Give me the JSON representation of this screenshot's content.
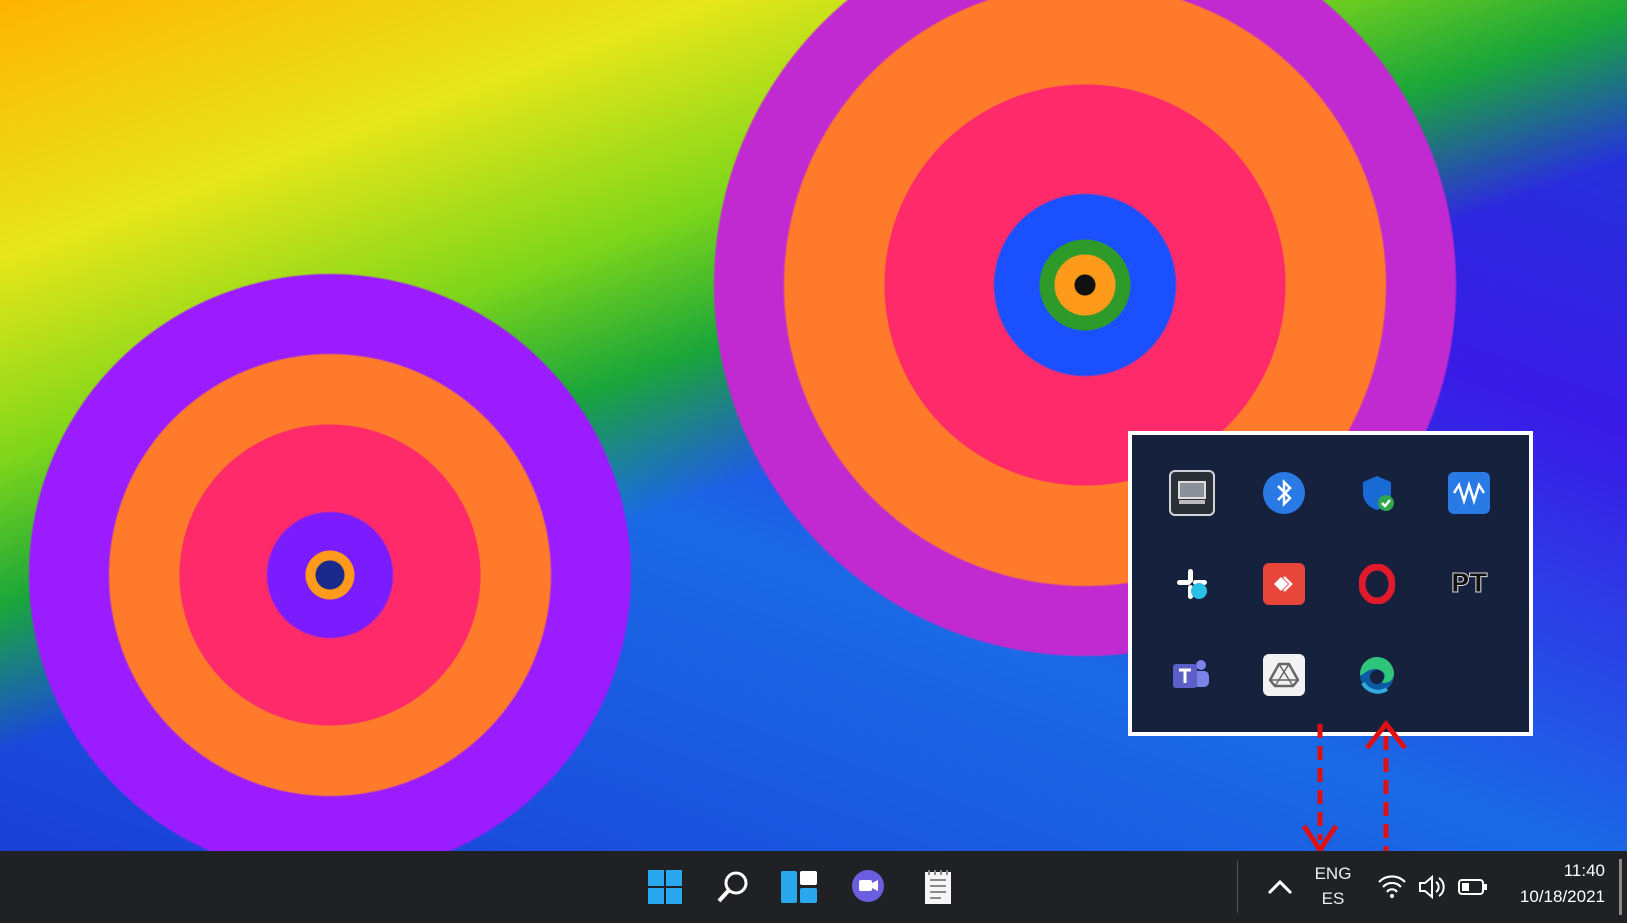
{
  "desktop": {
    "wallpaper": "fractal-spirals",
    "colors": {
      "blue": "#1a3fd6",
      "orange": "#ff7a2a",
      "pink": "#ff2a6a",
      "yellow": "#ffb400",
      "green": "#1aa63a"
    }
  },
  "tray_popup": {
    "icons": [
      {
        "name": "device-icon",
        "glyph": "▭",
        "bg": "#2b2f36"
      },
      {
        "name": "bluetooth-icon",
        "glyph": "ᛒ",
        "bg": "#2a7ae6"
      },
      {
        "name": "windows-security-icon",
        "glyph": "✔",
        "bg": "#1a6ad6"
      },
      {
        "name": "waves-audio-icon",
        "glyph": "≋",
        "bg": "#2a7ae6"
      },
      {
        "name": "slack-icon",
        "glyph": "✱",
        "bg": "#16213e"
      },
      {
        "name": "anydesk-icon",
        "glyph": "◆",
        "bg": "#e8463a"
      },
      {
        "name": "opera-icon",
        "glyph": "O",
        "bg": "#16213e"
      },
      {
        "name": "pt-icon",
        "glyph": "PT",
        "bg": "#16213e"
      },
      {
        "name": "teams-icon",
        "glyph": "T",
        "bg": "#5b5fc7"
      },
      {
        "name": "google-drive-icon",
        "glyph": "△",
        "bg": "#e8e8e8"
      },
      {
        "name": "edge-icon",
        "glyph": "◐",
        "bg": "#16213e"
      }
    ]
  },
  "taskbar": {
    "apps": [
      {
        "name": "start-button",
        "glyph": "⊞"
      },
      {
        "name": "search-button",
        "glyph": "⌕"
      },
      {
        "name": "widgets-button",
        "glyph": "▦"
      },
      {
        "name": "chat-button",
        "glyph": "●"
      },
      {
        "name": "notepad-button",
        "glyph": "▤"
      }
    ],
    "tray": {
      "overflow_glyph": "^",
      "language_line1": "ENG",
      "language_line2": "ES",
      "wifi_icon": "wifi-icon",
      "volume_icon": "volume-icon",
      "battery_icon": "battery-icon"
    },
    "clock": {
      "time": "11:40",
      "date": "10/18/2021"
    }
  },
  "annotations": {
    "arrow_color": "#e01010"
  }
}
